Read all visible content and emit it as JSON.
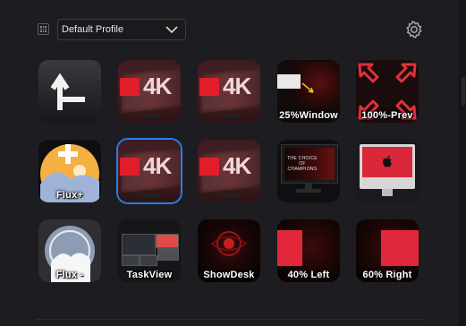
{
  "header": {
    "profile_selected": "Default Profile",
    "icons": {
      "grid": "grid-icon",
      "chevron": "chevron-down-icon",
      "settings": "gear-icon"
    }
  },
  "keys": [
    {
      "id": "back",
      "label": "",
      "icon": "back-arrow-icon"
    },
    {
      "id": "4k-1",
      "label": "",
      "art_text": "4K"
    },
    {
      "id": "4k-2",
      "label": "",
      "art_text": "4K"
    },
    {
      "id": "window",
      "label": "25%Window"
    },
    {
      "id": "prev",
      "label": "100%-Prev"
    },
    {
      "id": "flux-plus",
      "label": "Flux+"
    },
    {
      "id": "4k-3",
      "label": "",
      "art_text": "4K",
      "selected": true
    },
    {
      "id": "4k-4",
      "label": "",
      "art_text": "4K"
    },
    {
      "id": "monitor",
      "label": "",
      "art_text": "THE CHOICE OF CHAMPIONS"
    },
    {
      "id": "imac",
      "label": ""
    },
    {
      "id": "flux-minus",
      "label": "Flux -"
    },
    {
      "id": "taskview",
      "label": "TaskView"
    },
    {
      "id": "showdesk",
      "label": "ShowDesk"
    },
    {
      "id": "left40",
      "label": "40% Left"
    },
    {
      "id": "right60",
      "label": "60% Right"
    }
  ],
  "colors": {
    "background": "#1d1d21",
    "selection": "#2b7de9",
    "accent_red": "#e21d2a"
  }
}
